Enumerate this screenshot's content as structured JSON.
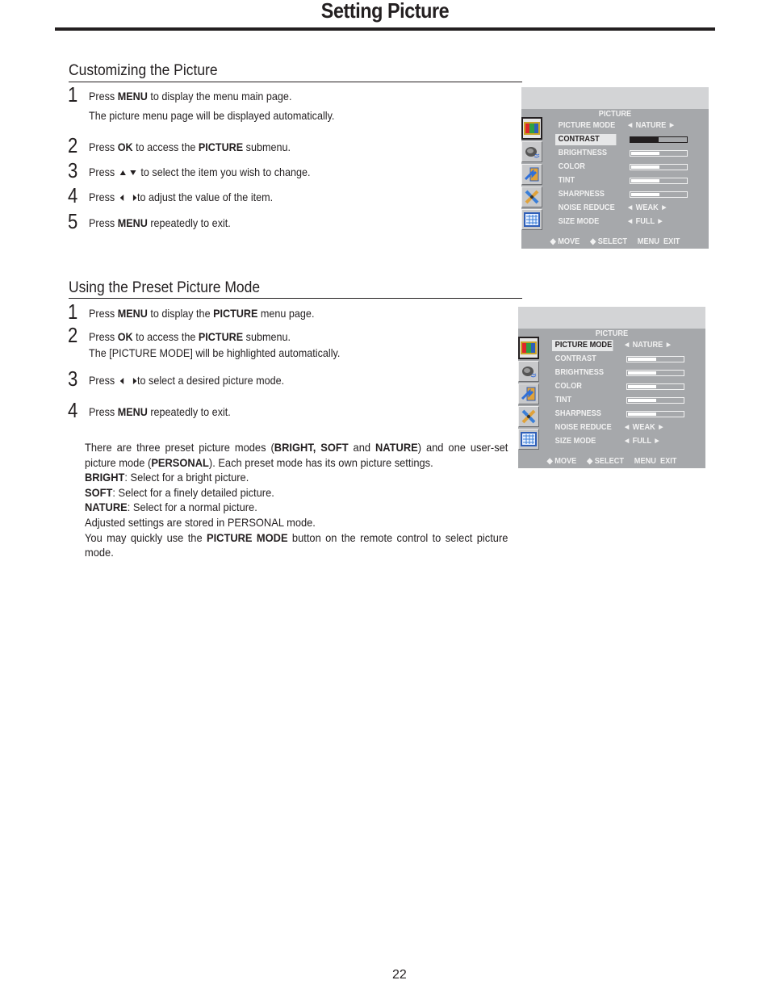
{
  "page": {
    "title": "Setting Picture",
    "page_number": "22"
  },
  "section1": {
    "heading": "Customizing the Picture",
    "steps": [
      {
        "num": "1",
        "parts": [
          {
            "t": "Press  "
          },
          {
            "b": "MENU"
          },
          {
            "t": " to display the menu main page."
          }
        ],
        "sub": "The picture menu page will be displayed automatically."
      },
      {
        "num": "2",
        "parts": [
          {
            "t": "Press "
          },
          {
            "b": "OK"
          },
          {
            "t": " to access the "
          },
          {
            "b": "PICTURE"
          },
          {
            "t": " submenu."
          }
        ]
      },
      {
        "num": "3",
        "parts": [
          {
            "t": "Press "
          },
          {
            "icon": "up-down"
          },
          {
            "t": " to select the item you wish to change."
          }
        ]
      },
      {
        "num": "4",
        "parts": [
          {
            "t": "Press "
          },
          {
            "icon": "left-right"
          },
          {
            "t": "to adjust the value of the item."
          }
        ]
      },
      {
        "num": "5",
        "parts": [
          {
            "t": "Press "
          },
          {
            "b": "MENU"
          },
          {
            "t": " repeatedly to exit."
          }
        ]
      }
    ]
  },
  "section2": {
    "heading": "Using the Preset Picture Mode",
    "steps": [
      {
        "num": "1",
        "parts": [
          {
            "t": "Press  "
          },
          {
            "b": "MENU"
          },
          {
            "t": " to display the "
          },
          {
            "b": "PICTURE"
          },
          {
            "t": " menu page."
          }
        ]
      },
      {
        "num": "2",
        "parts": [
          {
            "t": "Press "
          },
          {
            "b": "OK"
          },
          {
            "t": " to access the "
          },
          {
            "b": "PICTURE"
          },
          {
            "t": " submenu."
          }
        ],
        "sub": "The [PICTURE MODE] will be highlighted automatically."
      },
      {
        "num": "3",
        "parts": [
          {
            "t": "Press "
          },
          {
            "icon": "left-right"
          },
          {
            "t": "to select a desired picture mode."
          }
        ]
      },
      {
        "num": "4",
        "parts": [
          {
            "t": "Press "
          },
          {
            "b": "MENU"
          },
          {
            "t": " repeatedly to exit."
          }
        ]
      }
    ],
    "description": [
      [
        {
          "t": "There are three preset picture modes ("
        },
        {
          "b": "BRIGHT, SOFT"
        },
        {
          "t": " and "
        },
        {
          "b": "NATURE"
        },
        {
          "t": ") and one user-set"
        }
      ],
      [
        {
          "t": "picture mode ("
        },
        {
          "b": "PERSONAL"
        },
        {
          "t": "). Each preset mode has its own picture settings."
        }
      ],
      [
        {
          "b": "BRIGHT"
        },
        {
          "t": ": Select for a bright picture."
        }
      ],
      [
        {
          "b": "SOFT"
        },
        {
          "t": ": Select for a finely detailed picture."
        }
      ],
      [
        {
          "b": "NATURE"
        },
        {
          "t": ": Select for a normal picture."
        }
      ],
      [
        {
          "t": "Adjusted settings are stored in PERSONAL mode."
        }
      ],
      [
        {
          "t": "You may quickly use the "
        },
        {
          "b": "PICTURE MODE"
        },
        {
          "t": "  button on the remote control to  select picture"
        }
      ],
      [
        {
          "t": "mode."
        }
      ]
    ]
  },
  "osd_menus": [
    {
      "title": "PICTURE",
      "highlighted": "CONTRAST",
      "icons": [
        "color-bars-icon",
        "speaker-icon",
        "screen-arrow-icon",
        "tools-icon",
        "grid-icon"
      ],
      "rows": [
        {
          "label": "PICTURE MODE",
          "type": "select",
          "value": "◄ NATURE ►"
        },
        {
          "label": "CONTRAST",
          "type": "bar",
          "level": 0.5
        },
        {
          "label": "BRIGHTNESS",
          "type": "bar",
          "level": 0.5
        },
        {
          "label": "COLOR",
          "type": "bar",
          "level": 0.5
        },
        {
          "label": "TINT",
          "type": "bar",
          "level": 0.5
        },
        {
          "label": "SHARPNESS",
          "type": "bar",
          "level": 0.5
        },
        {
          "label": "NOISE REDUCE",
          "type": "select",
          "value": "◄  WEAK  ►"
        },
        {
          "label": "SIZE MODE",
          "type": "select",
          "value": "◄   FULL   ►"
        }
      ],
      "footer": "◆ MOVE     ◆ SELECT     MENU  EXIT"
    },
    {
      "title": "PICTURE",
      "highlighted": "PICTURE MODE",
      "icons": [
        "color-bars-icon",
        "speaker-icon",
        "screen-arrow-icon",
        "tools-icon",
        "grid-icon"
      ],
      "rows": [
        {
          "label": "PICTURE MODE",
          "type": "select",
          "value": "◄ NATURE ►"
        },
        {
          "label": "CONTRAST",
          "type": "bar",
          "level": 0.5
        },
        {
          "label": "BRIGHTNESS",
          "type": "bar",
          "level": 0.5
        },
        {
          "label": "COLOR",
          "type": "bar",
          "level": 0.5
        },
        {
          "label": "TINT",
          "type": "bar",
          "level": 0.5
        },
        {
          "label": "SHARPNESS",
          "type": "bar",
          "level": 0.5
        },
        {
          "label": "NOISE REDUCE",
          "type": "select",
          "value": "◄  WEAK  ►"
        },
        {
          "label": "SIZE MODE",
          "type": "select",
          "value": "◄   FULL   ►"
        }
      ],
      "footer": "◆ MOVE     ◆ SELECT     MENU  EXIT"
    }
  ]
}
